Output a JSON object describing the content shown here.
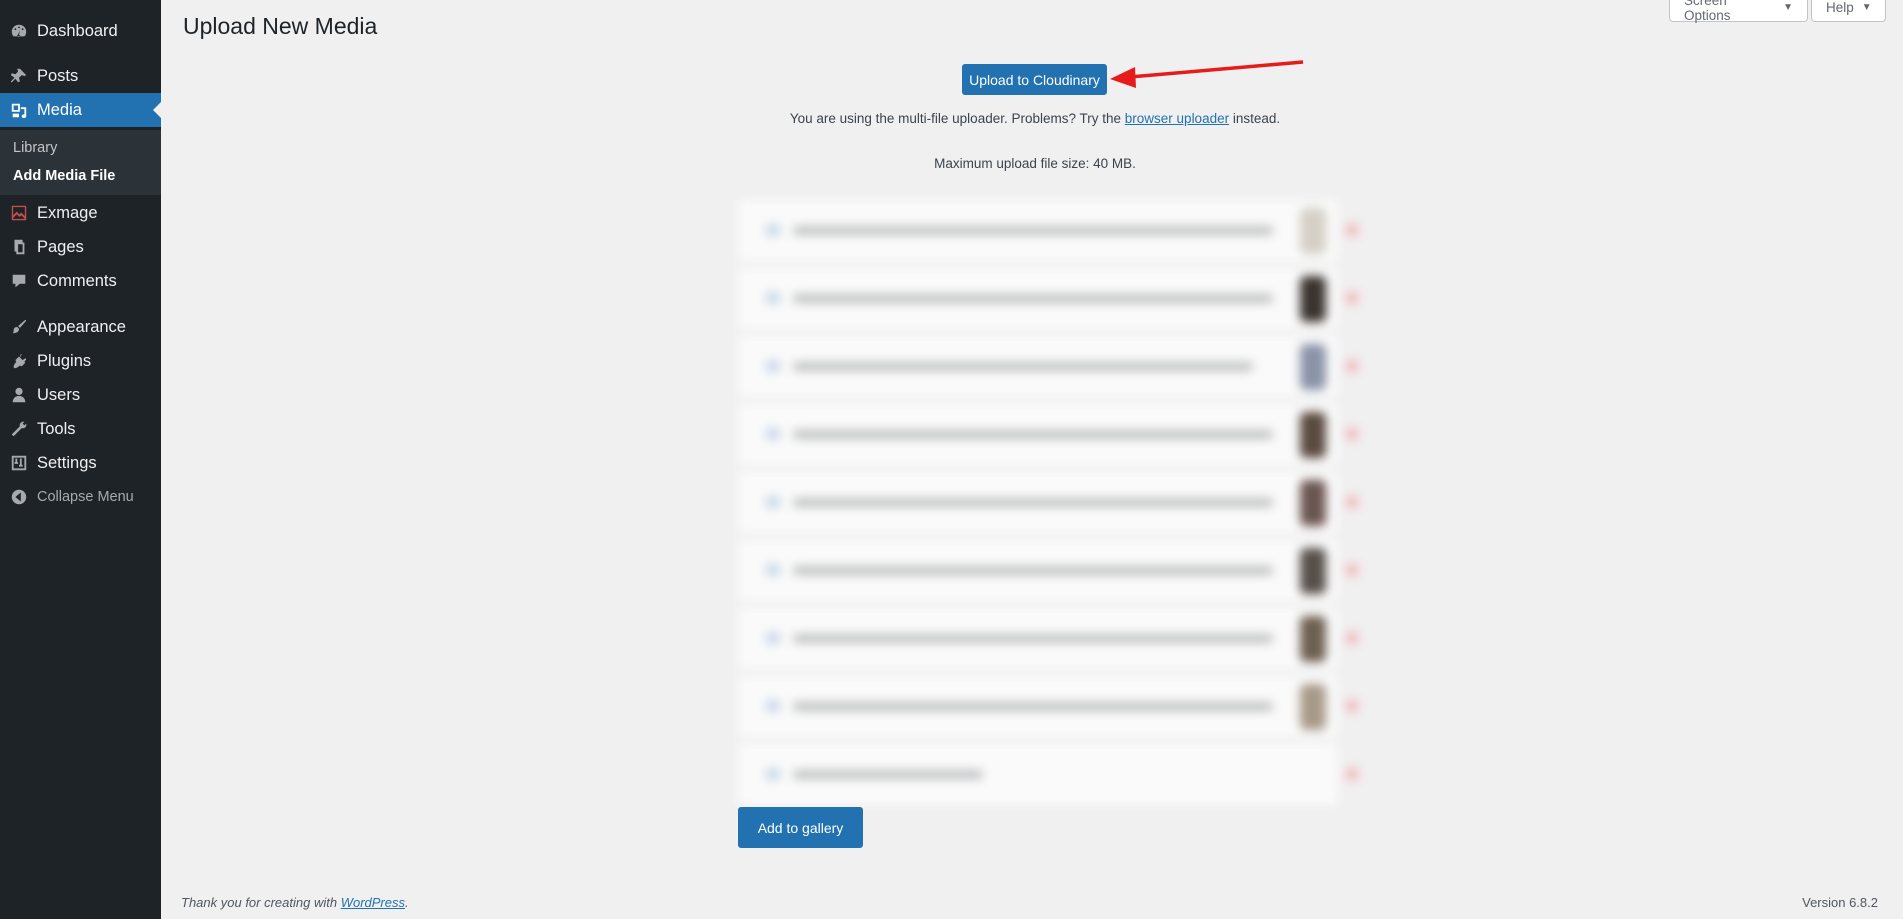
{
  "sidebar": {
    "items": [
      {
        "label": "Dashboard",
        "icon": "dashboard-icon"
      },
      {
        "label": "Posts",
        "icon": "pin-icon"
      },
      {
        "label": "Media",
        "icon": "media-icon"
      },
      {
        "label": "Exmage",
        "icon": "image-icon"
      },
      {
        "label": "Pages",
        "icon": "pages-icon"
      },
      {
        "label": "Comments",
        "icon": "comment-icon"
      },
      {
        "label": "Appearance",
        "icon": "paintbrush-icon"
      },
      {
        "label": "Plugins",
        "icon": "plugin-icon"
      },
      {
        "label": "Users",
        "icon": "user-icon"
      },
      {
        "label": "Tools",
        "icon": "wrench-icon"
      },
      {
        "label": "Settings",
        "icon": "settings-icon"
      }
    ],
    "submenu": [
      {
        "label": "Library"
      },
      {
        "label": "Add Media File"
      }
    ],
    "collapse_label": "Collapse Menu"
  },
  "header": {
    "title": "Upload New Media",
    "screen_options_label": "Screen Options",
    "help_label": "Help"
  },
  "main": {
    "upload_button_label": "Upload to Cloudinary",
    "uploader_text_before": "You are using the multi-file uploader. Problems? Try the",
    "uploader_link": "browser uploader",
    "uploader_text_after": "instead.",
    "max_size_text": "Maximum upload file size: 40 MB.",
    "gallery_button_label": "Add to gallery"
  },
  "footer": {
    "thanks_text": "Thank you for creating with",
    "thanks_link": "WordPress",
    "version": "Version 6.8.2"
  },
  "colors": {
    "accent": "#2271b1",
    "sidebar_bg": "#1d2327",
    "annotation_arrow": "#e81b1b"
  }
}
